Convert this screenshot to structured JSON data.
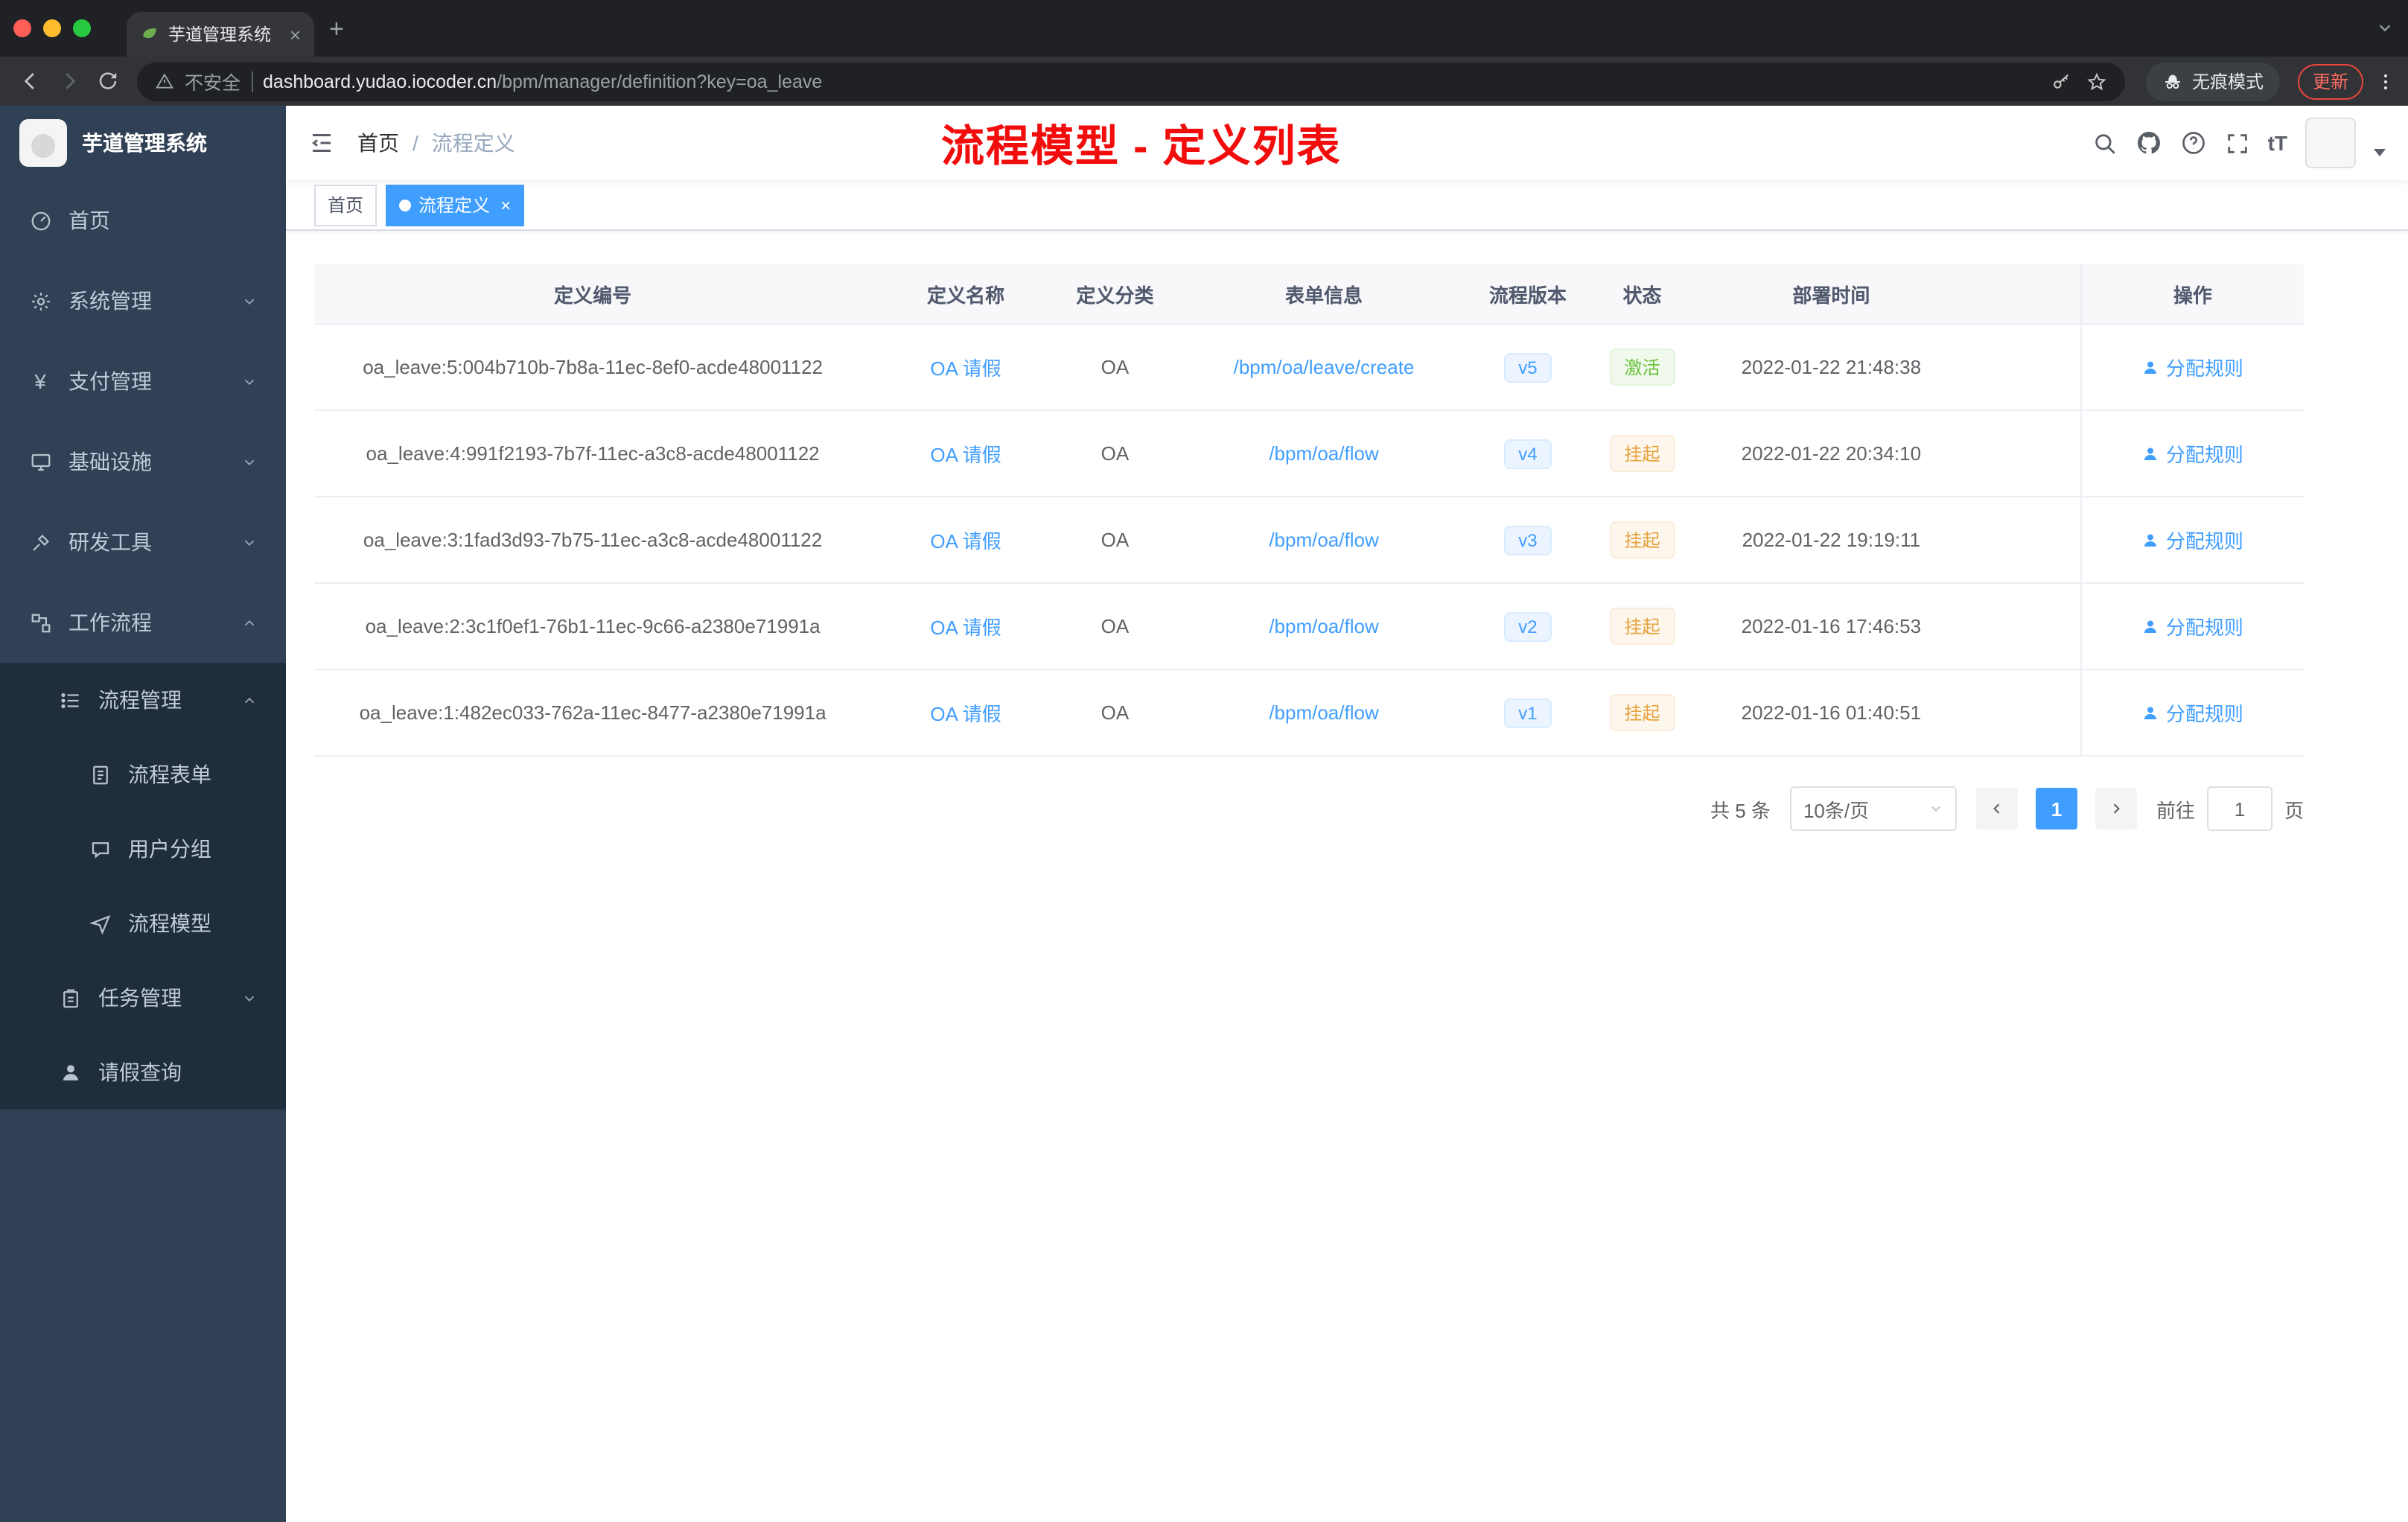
{
  "browser": {
    "tab_title": "芋道管理系统",
    "security": "不安全",
    "url_host": "dashboard.yudao.iocoder.cn",
    "url_path": "/bpm/manager/definition?key=oa_leave",
    "incognito": "无痕模式",
    "update": "更新"
  },
  "sidebar": {
    "title": "芋道管理系统",
    "items": [
      {
        "label": "首页"
      },
      {
        "label": "系统管理"
      },
      {
        "label": "支付管理"
      },
      {
        "label": "基础设施"
      },
      {
        "label": "研发工具"
      },
      {
        "label": "工作流程"
      },
      {
        "label": "流程管理"
      },
      {
        "label": "流程表单"
      },
      {
        "label": "用户分组"
      },
      {
        "label": "流程模型"
      },
      {
        "label": "任务管理"
      },
      {
        "label": "请假查询"
      }
    ]
  },
  "header": {
    "breadcrumb_home": "首页",
    "breadcrumb_sep": "/",
    "breadcrumb_current": "流程定义",
    "annotation": "流程模型 - 定义列表",
    "font_icon": "tT"
  },
  "tags": {
    "home": "首页",
    "active": "流程定义"
  },
  "table": {
    "headers": [
      "定义编号",
      "定义名称",
      "定义分类",
      "表单信息",
      "流程版本",
      "状态",
      "部署时间",
      "操作"
    ],
    "rows": [
      {
        "id": "oa_leave:5:004b710b-7b8a-11ec-8ef0-acde48001122",
        "name": "OA 请假",
        "category": "OA",
        "form": "/bpm/oa/leave/create",
        "version": "v5",
        "status": "激活",
        "status_type": "success",
        "deploy_time": "2022-01-22 21:48:38",
        "action": "分配规则"
      },
      {
        "id": "oa_leave:4:991f2193-7b7f-11ec-a3c8-acde48001122",
        "name": "OA 请假",
        "category": "OA",
        "form": "/bpm/oa/flow",
        "version": "v4",
        "status": "挂起",
        "status_type": "warning",
        "deploy_time": "2022-01-22 20:34:10",
        "action": "分配规则"
      },
      {
        "id": "oa_leave:3:1fad3d93-7b75-11ec-a3c8-acde48001122",
        "name": "OA 请假",
        "category": "OA",
        "form": "/bpm/oa/flow",
        "version": "v3",
        "status": "挂起",
        "status_type": "warning",
        "deploy_time": "2022-01-22 19:19:11",
        "action": "分配规则"
      },
      {
        "id": "oa_leave:2:3c1f0ef1-76b1-11ec-9c66-a2380e71991a",
        "name": "OA 请假",
        "category": "OA",
        "form": "/bpm/oa/flow",
        "version": "v2",
        "status": "挂起",
        "status_type": "warning",
        "deploy_time": "2022-01-16 17:46:53",
        "action": "分配规则"
      },
      {
        "id": "oa_leave:1:482ec033-762a-11ec-8477-a2380e71991a",
        "name": "OA 请假",
        "category": "OA",
        "form": "/bpm/oa/flow",
        "version": "v1",
        "status": "挂起",
        "status_type": "warning",
        "deploy_time": "2022-01-16 01:40:51",
        "action": "分配规则"
      }
    ]
  },
  "pagination": {
    "total": "共 5 条",
    "page_size": "10条/页",
    "page": "1",
    "goto": "前往",
    "unit": "页",
    "goto_value": "1"
  },
  "colors": {
    "accent": "#409eff",
    "success": "#67c23a",
    "warning": "#e6a23c",
    "annotation": "#f20d0d",
    "sidebar_bg": "#304156",
    "submenu_bg": "#1f2d3c"
  }
}
